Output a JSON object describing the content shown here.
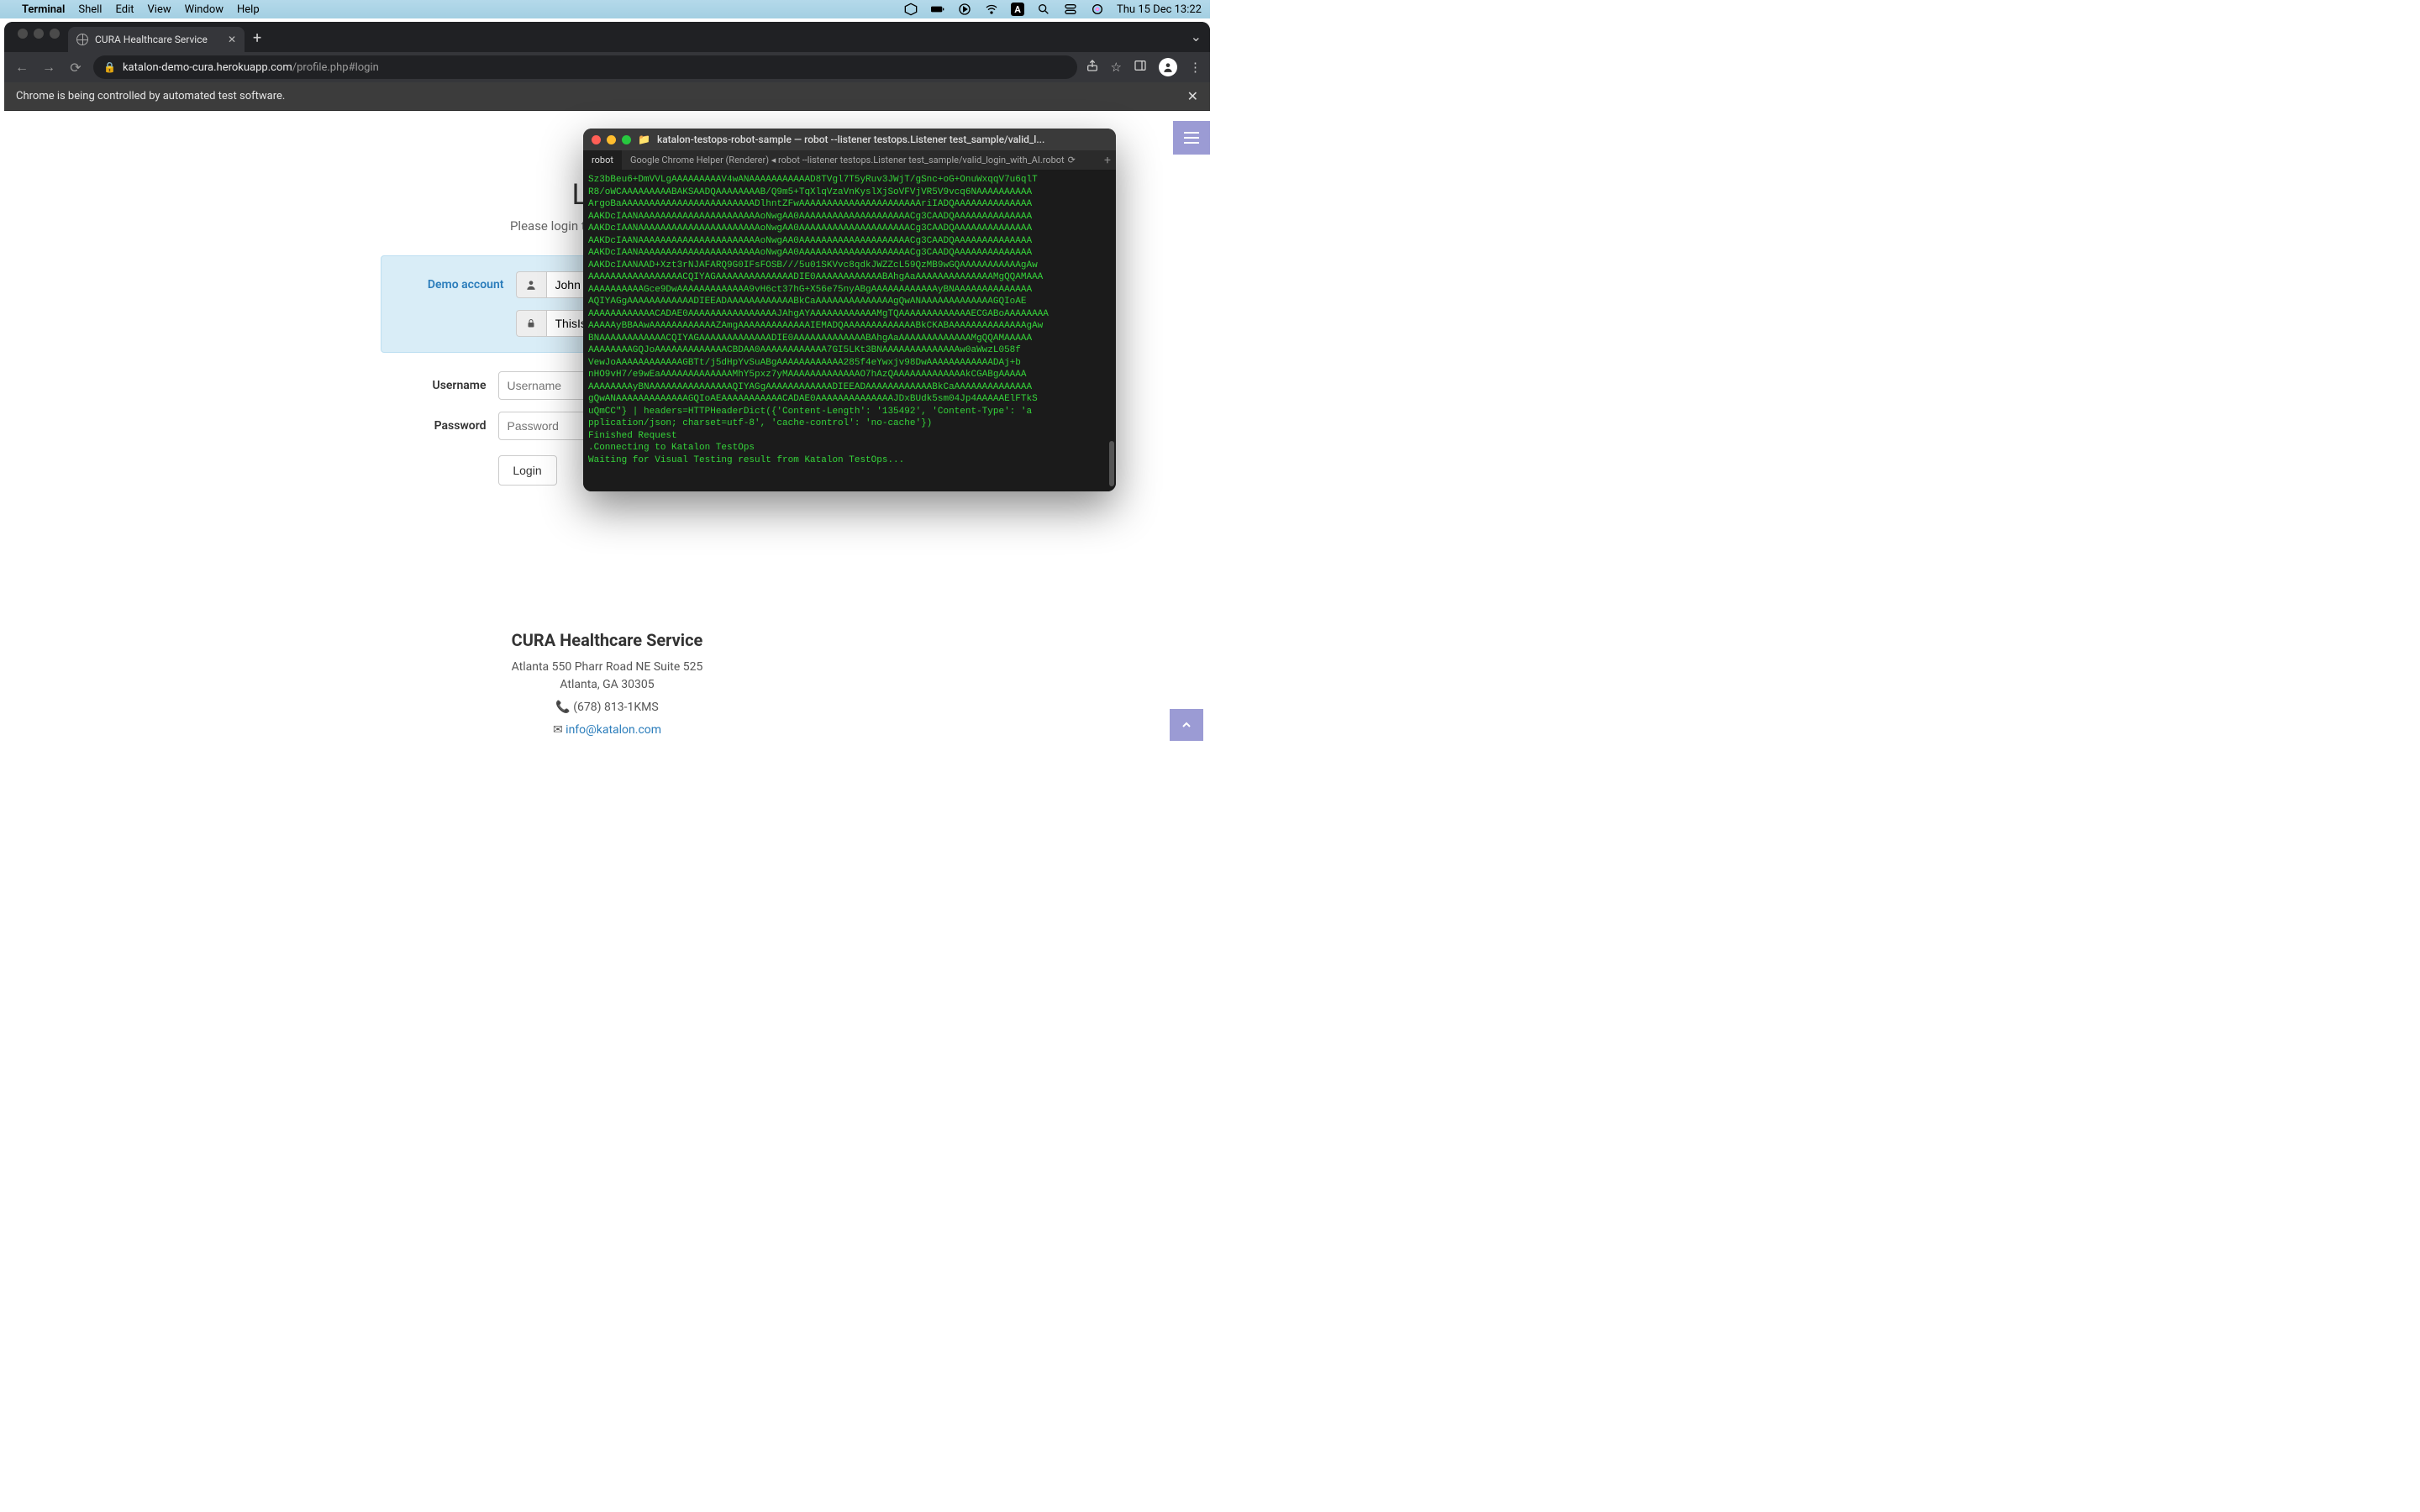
{
  "menubar": {
    "app": "Terminal",
    "items": [
      "Shell",
      "Edit",
      "View",
      "Window",
      "Help"
    ],
    "clock": "Thu 15 Dec  13:22"
  },
  "chrome": {
    "tab_title": "CURA Healthcare Service",
    "url_host": "katalon-demo-cura.herokuapp.com",
    "url_path": "/profile.php#login",
    "infobar": "Chrome is being controlled by automated test software."
  },
  "page": {
    "title": "Login",
    "subtitle": "Please login to make appointment.",
    "demo_label": "Demo account",
    "demo_username_value": "John Doe",
    "demo_password_value": "ThisIsNotAPassword",
    "username_label": "Username",
    "username_placeholder": "Username",
    "password_label": "Password",
    "password_placeholder": "Password",
    "login_button": "Login"
  },
  "footer": {
    "title": "CURA Healthcare Service",
    "addr1": "Atlanta 550 Pharr Road NE Suite 525",
    "addr2": "Atlanta, GA 30305",
    "phone": "(678) 813-1KMS",
    "email": "info@katalon.com"
  },
  "terminal": {
    "window_title": "katalon-testops-robot-sample — robot --listener testops.Listener test_sample/valid_l...",
    "tab1": "robot",
    "tab2": "Google Chrome Helper (Renderer) ◂ robot --listener testops.Listener test_sample/valid_login_with_AI.robot",
    "lines": [
      "Sz3bBeu6+DmVVLgAAAAAAAAAV4wANAAAAAAAAAAAD8TVgl7T5yRuv3JWjT/gSnc+oG+OnuWxqqV7u6qlT",
      "R8/oWCAAAAAAAAABAKSAADQAAAAAAAAB/Q9m5+TqXlqVzaVnKyslXjSoVFVjVR5V9vcq6NAAAAAAAAAA",
      "ArgoBaAAAAAAAAAAAAAAAAAAAAAAAADlhntZFwAAAAAAAAAAAAAAAAAAAAAAriIADQAAAAAAAAAAAAAA",
      "AAKDcIAANAAAAAAAAAAAAAAAAAAAAAAoNwgAA0AAAAAAAAAAAAAAAAAAAACg3CAADQAAAAAAAAAAAAAA",
      "AAKDcIAANAAAAAAAAAAAAAAAAAAAAAAoNwgAA0AAAAAAAAAAAAAAAAAAAACg3CAADQAAAAAAAAAAAAAA",
      "AAKDcIAANAAAAAAAAAAAAAAAAAAAAAAoNwgAA0AAAAAAAAAAAAAAAAAAAACg3CAADQAAAAAAAAAAAAAA",
      "AAKDcIAANAAAAAAAAAAAAAAAAAAAAAAoNwgAA0AAAAAAAAAAAAAAAAAAAACg3CAADQAAAAAAAAAAAAAA",
      "AAKDcIAANAAD+Xzt3rNJAFARQ9G0IFsFOSB///5u01SKVvc8qdkJWZZcL59QzMB9wGQAAAAAAAAAAAgAw",
      "AAAAAAAAAAAAAAAAACQIYAGAAAAAAAAAAAAAADIE0AAAAAAAAAAAABAhgAaAAAAAAAAAAAAAAMgQQAMAAA",
      "AAAAAAAAAAGce9DwAAAAAAAAAAAAA9vH6ct37hG+X56e75nyABgAAAAAAAAAAAAyBNAAAAAAAAAAAAAA",
      "AQIYAGgAAAAAAAAAAAADIEEADAAAAAAAAAAAABkCaAAAAAAAAAAAAAAgQwANAAAAAAAAAAAAAGQIoAE",
      "AAAAAAAAAAAACADAE0AAAAAAAAAAAAAAAAJAhgAYAAAAAAAAAAAAMgTQAAAAAAAAAAAAAECGABoAAAAAAAA",
      "AAAAAyBBAAwAAAAAAAAAAAAZAmgAAAAAAAAAAAAAIEMADQAAAAAAAAAAAAABkCKABAAAAAAAAAAAAAAgAw",
      "BNAAAAAAAAAAAACQIYAGAAAAAAAAAAAAADIE0AAAAAAAAAAAAABAhgAaAAAAAAAAAAAAAMgQQAMAAAAA",
      "AAAAAAAAGQJoAAAAAAAAAAAAACBDAA0AAAAAAAAAAAA7GI5LKt3BNAAAAAAAAAAAAAAw0aWwzL058f",
      "VewJoAAAAAAAAAAAAGBTt/j5dHpYvSuABgAAAAAAAAAAAA285f4eYwxjv98DwAAAAAAAAAAAADAj+b",
      "nHO9vH7/e9wEaAAAAAAAAAAAAAMhY5pxz7yMAAAAAAAAAAAAAO7hAzQAAAAAAAAAAAAAkCGABgAAAAA",
      "AAAAAAAAyBNAAAAAAAAAAAAAAAQIYAGgAAAAAAAAAAAADIEEADAAAAAAAAAAAABkCaAAAAAAAAAAAAAA",
      "gQwANAAAAAAAAAAAAAGQIoAEAAAAAAAAAAACADAE0AAAAAAAAAAAAAAJDxBUdk5sm04Jp4AAAAAElFTkS",
      "uQmCC\"} | headers=HTTPHeaderDict({'Content-Length': '135492', 'Content-Type': 'a",
      "pplication/json; charset=utf-8', 'cache-control': 'no-cache'})",
      "Finished Request",
      ".Connecting to Katalon TestOps",
      "Waiting for Visual Testing result from Katalon TestOps..."
    ]
  }
}
